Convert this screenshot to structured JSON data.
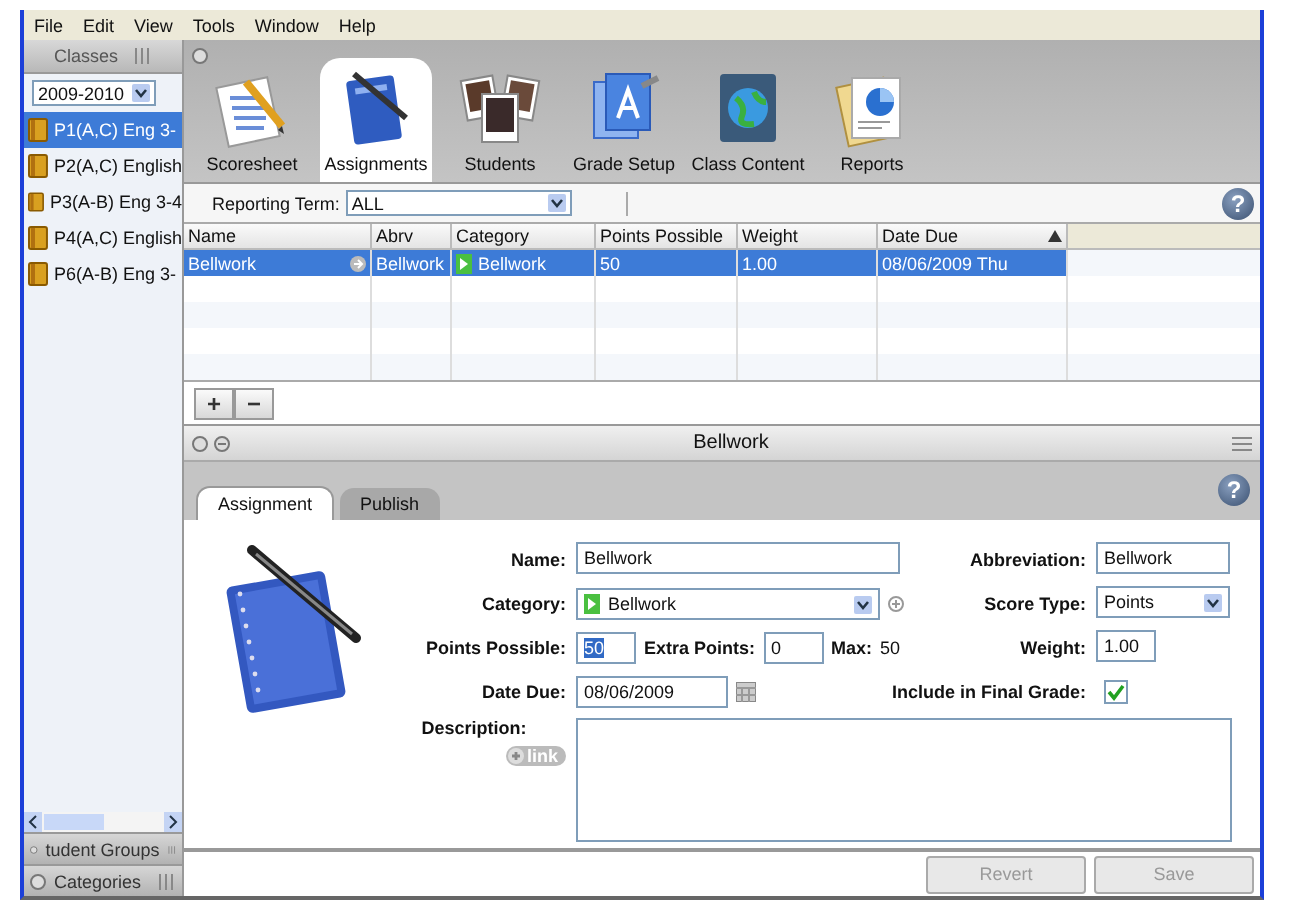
{
  "menu": [
    "File",
    "Edit",
    "View",
    "Tools",
    "Window",
    "Help"
  ],
  "sidebar": {
    "header": "Classes",
    "year": "2009-2010",
    "classes": [
      {
        "name": "P1(A,C) Eng 3-",
        "selected": true
      },
      {
        "name": "P2(A,C) English",
        "selected": false
      },
      {
        "name": "P3(A-B) Eng 3-4",
        "selected": false
      },
      {
        "name": "P4(A,C) English",
        "selected": false
      },
      {
        "name": "P6(A-B) Eng 3-",
        "selected": false
      }
    ],
    "panels": [
      "tudent Groups",
      "Categories"
    ]
  },
  "toolbar": {
    "tabs": [
      {
        "label": "Scoresheet",
        "selected": false
      },
      {
        "label": "Assignments",
        "selected": true
      },
      {
        "label": "Students",
        "selected": false
      },
      {
        "label": "Grade Setup",
        "selected": false
      },
      {
        "label": "Class Content",
        "selected": false
      },
      {
        "label": "Reports",
        "selected": false
      }
    ]
  },
  "filter": {
    "label": "Reporting Term:",
    "value": "ALL",
    "help": "?"
  },
  "table": {
    "columns": [
      {
        "label": "Name",
        "sorted": false
      },
      {
        "label": "Abrv",
        "sorted": false
      },
      {
        "label": "Category",
        "sorted": false
      },
      {
        "label": "Points Possible",
        "sorted": false
      },
      {
        "label": "Weight",
        "sorted": false
      },
      {
        "label": "Date Due",
        "sorted": true
      }
    ],
    "rows": [
      {
        "cells": [
          "Bellwork",
          "Bellwork",
          "Bellwork",
          "50",
          "1.00",
          "08/06/2009 Thu"
        ],
        "selected": true
      }
    ],
    "add": "+",
    "remove": "−"
  },
  "detail": {
    "title": "Bellwork",
    "help": "?",
    "tabs": [
      {
        "label": "Assignment",
        "selected": true
      },
      {
        "label": "Publish",
        "selected": false
      }
    ],
    "form": {
      "name": {
        "label": "Name:",
        "value": "Bellwork"
      },
      "abbreviation": {
        "label": "Abbreviation:",
        "value": "Bellwork"
      },
      "category": {
        "label": "Category:",
        "value": "Bellwork"
      },
      "score_type": {
        "label": "Score Type:",
        "value": "Points"
      },
      "points_possible": {
        "label": "Points Possible:",
        "value": "50",
        "highlighted": true
      },
      "extra_points": {
        "label": "Extra Points:",
        "value": "0"
      },
      "max": {
        "label": "Max:",
        "value": "50"
      },
      "weight": {
        "label": "Weight:",
        "value": "1.00"
      },
      "date_due": {
        "label": "Date Due:",
        "value": "08/06/2009"
      },
      "include_final": {
        "label": "Include in Final Grade:",
        "checked": true
      },
      "description": {
        "label": "Description:",
        "link": "link"
      }
    },
    "buttons": [
      {
        "label": "Revert",
        "disabled": true
      },
      {
        "label": "Save",
        "disabled": true
      }
    ]
  }
}
